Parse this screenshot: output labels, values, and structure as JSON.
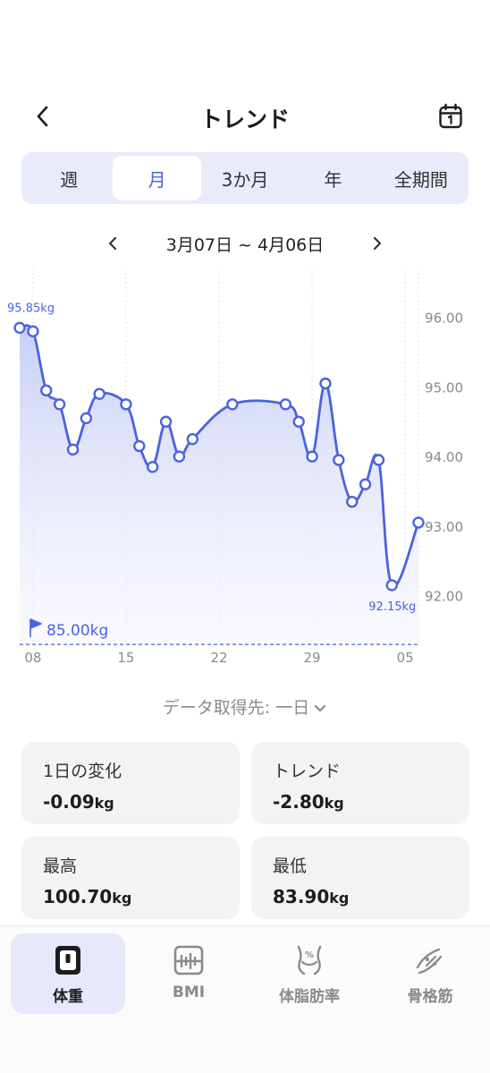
{
  "header": {
    "title": "トレンド",
    "back_icon": "chevron-left-icon",
    "calendar_icon": "calendar-icon"
  },
  "period_tabs": [
    {
      "label": "週",
      "active": false
    },
    {
      "label": "月",
      "active": true
    },
    {
      "label": "3か月",
      "active": false
    },
    {
      "label": "年",
      "active": false
    },
    {
      "label": "全期間",
      "active": false
    }
  ],
  "date_range": {
    "label": "3月07日 ~ 4月06日"
  },
  "chart_data": {
    "type": "area",
    "x_ticks": [
      "08",
      "15",
      "22",
      "29",
      "05"
    ],
    "y_ticks": [
      "96.00",
      "95.00",
      "94.00",
      "93.00",
      "92.00"
    ],
    "ylim": [
      91.3,
      96.6
    ],
    "max_label": "95.85kg",
    "min_label": "92.15kg",
    "goal_label": "85.00kg",
    "accent_color": "#4a63e0",
    "points": [
      {
        "x": "3/07",
        "y": 95.85
      },
      {
        "x": "3/08",
        "y": 95.8
      },
      {
        "x": "3/09",
        "y": 94.95
      },
      {
        "x": "3/10",
        "y": 94.75
      },
      {
        "x": "3/11",
        "y": 94.1
      },
      {
        "x": "3/12",
        "y": 94.55
      },
      {
        "x": "3/13",
        "y": 94.9
      },
      {
        "x": "3/15",
        "y": 94.75
      },
      {
        "x": "3/16",
        "y": 94.15
      },
      {
        "x": "3/17",
        "y": 93.85
      },
      {
        "x": "3/18",
        "y": 94.5
      },
      {
        "x": "3/19",
        "y": 94.0
      },
      {
        "x": "3/20",
        "y": 94.25
      },
      {
        "x": "3/23",
        "y": 94.75
      },
      {
        "x": "3/27",
        "y": 94.75
      },
      {
        "x": "3/28",
        "y": 94.5
      },
      {
        "x": "3/29",
        "y": 94.0
      },
      {
        "x": "3/30",
        "y": 95.05
      },
      {
        "x": "3/31",
        "y": 93.95
      },
      {
        "x": "4/01",
        "y": 93.35
      },
      {
        "x": "4/02",
        "y": 93.6
      },
      {
        "x": "4/03",
        "y": 93.95
      },
      {
        "x": "4/04",
        "y": 92.15
      },
      {
        "x": "4/06",
        "y": 93.05
      }
    ]
  },
  "data_source": {
    "label": "データ取得先: 一日"
  },
  "stats": {
    "daily_change": {
      "label": "1日の変化",
      "value": "-0.09",
      "unit": "kg"
    },
    "trend": {
      "label": "トレンド",
      "value": "-2.80",
      "unit": "kg"
    },
    "max": {
      "label": "最高",
      "value": "100.70",
      "unit": "kg"
    },
    "min": {
      "label": "最低",
      "value": "83.90",
      "unit": "kg"
    }
  },
  "tabbar": [
    {
      "label": "体重",
      "icon": "scale-icon",
      "active": true
    },
    {
      "label": "BMI",
      "icon": "bmi-icon",
      "active": false
    },
    {
      "label": "体脂肪率",
      "icon": "body-fat-icon",
      "active": false
    },
    {
      "label": "骨格筋",
      "icon": "muscle-icon",
      "active": false
    }
  ]
}
